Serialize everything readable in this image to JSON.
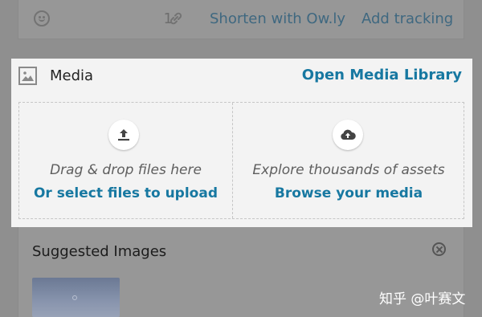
{
  "composer": {
    "char_count": "1",
    "shorten_label": "Shorten with Ow.ly",
    "tracking_label": "Add tracking"
  },
  "media": {
    "title": "Media",
    "open_library_label": "Open Media Library",
    "upload": {
      "hint": "Drag & drop files here",
      "action_label": "Or select files to upload"
    },
    "browse": {
      "hint": "Explore thousands of assets",
      "action_label": "Browse your media"
    }
  },
  "suggested": {
    "title": "Suggested Images"
  },
  "watermark": "知乎 @叶赛文",
  "colors": {
    "accent": "#1778a1",
    "overlay": "#8f8f8f",
    "panel": "#f3f3f3"
  }
}
